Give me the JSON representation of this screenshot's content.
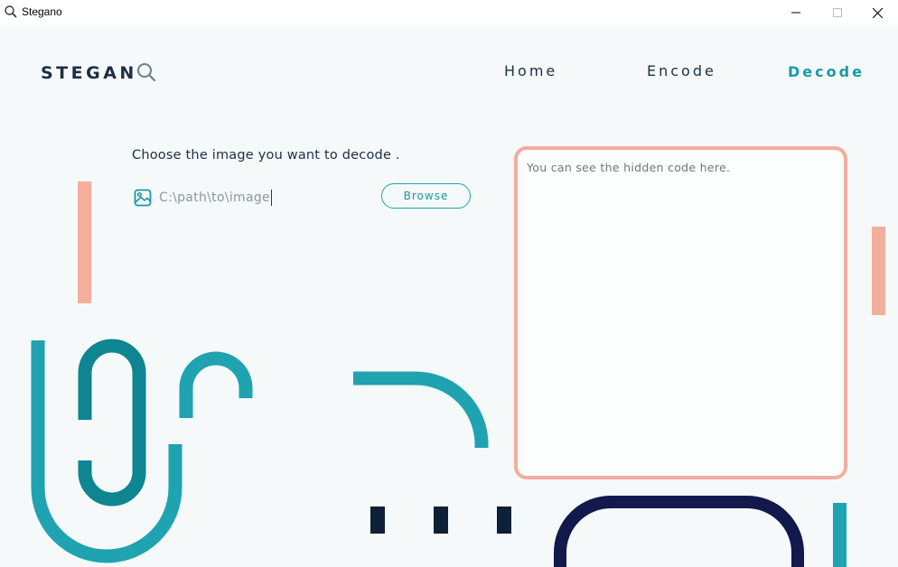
{
  "window": {
    "title": "Stegano",
    "icon": "search-icon",
    "controls": [
      "minimize-icon",
      "maximize-icon",
      "close-icon"
    ]
  },
  "header": {
    "logo_text": "STEGAN",
    "logo_icon": "search-icon",
    "nav": {
      "home": "Home",
      "encode": "Encode",
      "decode": "Decode"
    },
    "active_nav": "decode"
  },
  "decode": {
    "prompt": "Choose the image you want to decode .",
    "file_icon": "image-icon",
    "path_value": "C:\\path\\to\\image",
    "browse_label": "Browse",
    "output_placeholder": "You can see the hidden code here."
  },
  "colors": {
    "navy": "#1b2f47",
    "teal": "#1fa3b0",
    "dark_teal": "#0e8590",
    "salmon": "#f4ae9c",
    "midnight": "#13194c",
    "dark_navy": "#0c2138",
    "background": "#f5f9fa"
  }
}
